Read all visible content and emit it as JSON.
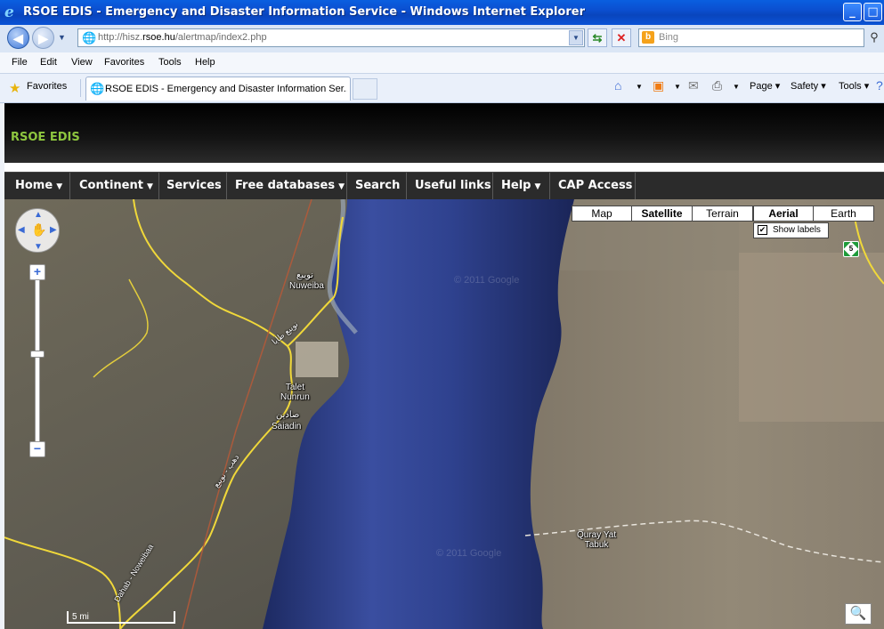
{
  "window": {
    "title": "RSOE EDIS - Emergency and Disaster Information Service - Windows Internet Explorer",
    "minimize": "_",
    "maximize": "□"
  },
  "address": {
    "url_prefix": "http://hisz.",
    "url_domain": "rsoe.hu",
    "url_path": "/alertmap/index2.php",
    "search_placeholder": "Bing"
  },
  "menu": [
    "File",
    "Edit",
    "View",
    "Favorites",
    "Tools",
    "Help"
  ],
  "favorites": {
    "label": "Favorites",
    "tab_title": "RSOE EDIS - Emergency and Disaster Information Ser..."
  },
  "commandbar": {
    "page": "Page ▾",
    "safety": "Safety ▾",
    "tools": "Tools ▾"
  },
  "site": {
    "logo": "RSOE EDIS",
    "nav": [
      {
        "label": "Home",
        "dropdown": true
      },
      {
        "label": "Continent",
        "dropdown": true
      },
      {
        "label": "Services",
        "dropdown": false
      },
      {
        "label": "Free databases",
        "dropdown": true
      },
      {
        "label": "Search",
        "dropdown": false
      },
      {
        "label": "Useful links",
        "dropdown": false
      },
      {
        "label": "Help",
        "dropdown": true
      },
      {
        "label": "CAP Access",
        "dropdown": false
      }
    ]
  },
  "map": {
    "types": [
      {
        "label": "Map",
        "active": false
      },
      {
        "label": "Satellite",
        "active": true
      },
      {
        "label": "Terrain",
        "active": false
      },
      {
        "label": "Aerial",
        "active": true
      },
      {
        "label": "Earth",
        "active": false
      }
    ],
    "show_labels": {
      "label": "Show labels",
      "checked": true
    },
    "scale": "5 mi",
    "labels": {
      "nuweiba_ar": "نويبع",
      "nuweiba": "Nuweiba",
      "talet_nunrun": "Talet\nNunrun",
      "saiadin_ar": "صادين",
      "saiadin": "Saiadin",
      "quray": "Quray Yat\nTabuk",
      "road1": "نويبع طابا",
      "road2": "دهب - نويبع",
      "road3": "Dahab - Noweibaa"
    },
    "highway_shield": "5",
    "watermark": "© 2011 Google",
    "colors": {
      "water": "#2b3f86",
      "land_left": "#7a7464",
      "land_right": "#8d8473",
      "road": "#f0d83a"
    }
  }
}
